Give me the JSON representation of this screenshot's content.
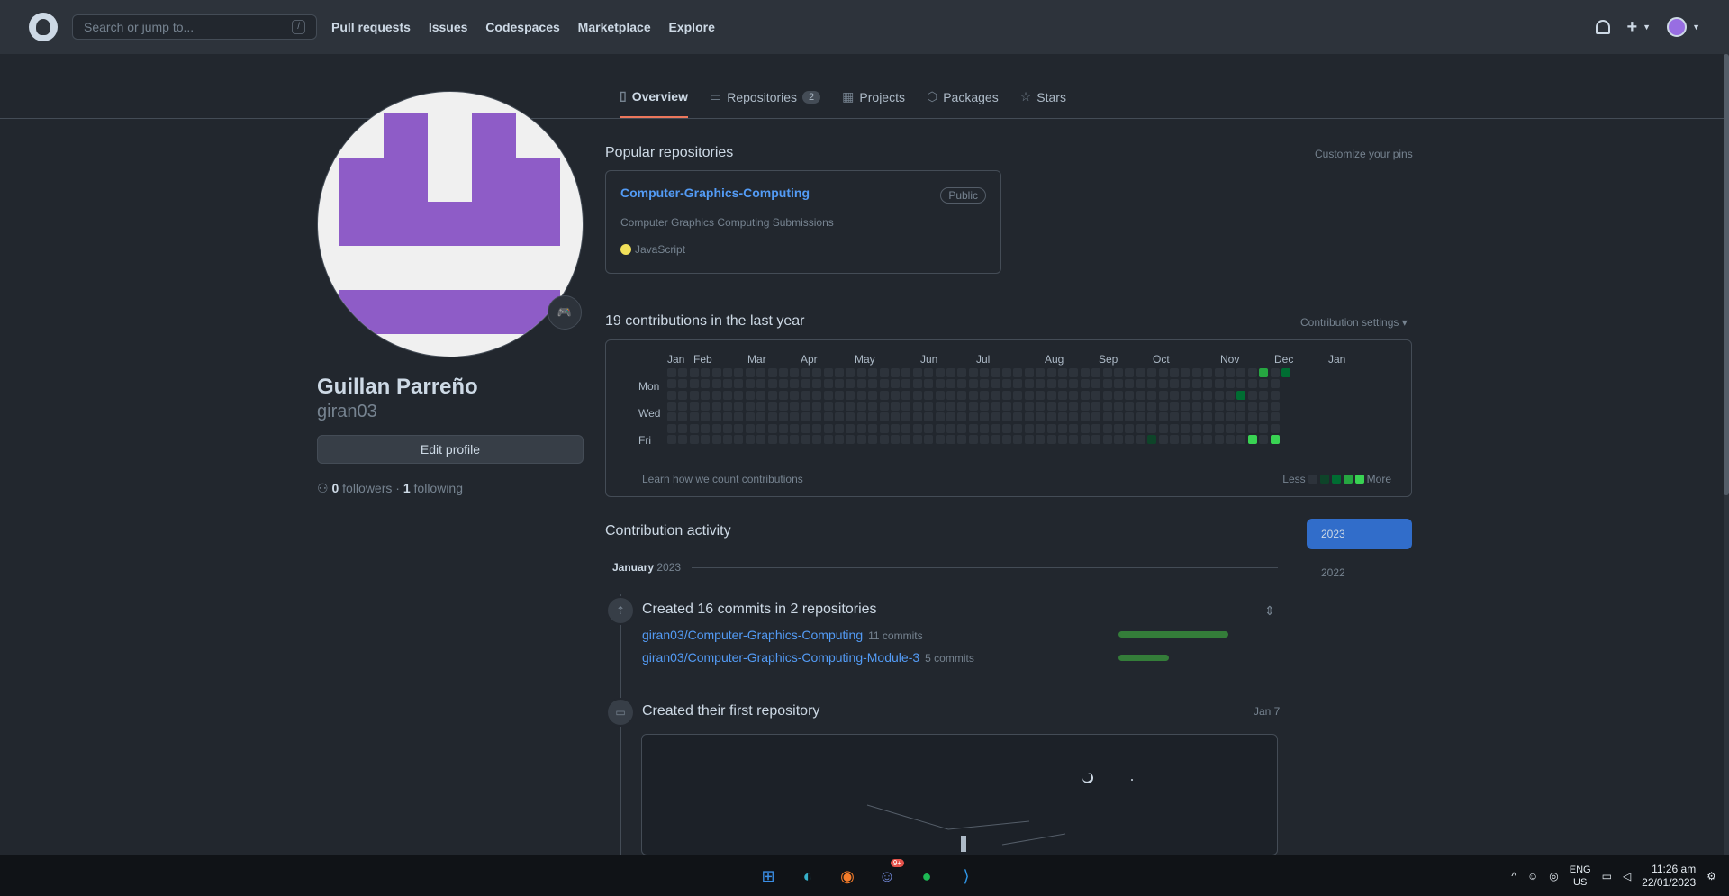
{
  "header": {
    "search_placeholder": "Search or jump to...",
    "search_shortcut": "/",
    "nav": [
      "Pull requests",
      "Issues",
      "Codespaces",
      "Marketplace",
      "Explore"
    ]
  },
  "tabs": [
    {
      "label": "Overview",
      "icon": "book-icon",
      "active": true
    },
    {
      "label": "Repositories",
      "icon": "repo-icon",
      "count": "2"
    },
    {
      "label": "Projects",
      "icon": "table-icon"
    },
    {
      "label": "Packages",
      "icon": "package-icon"
    },
    {
      "label": "Stars",
      "icon": "star-icon"
    }
  ],
  "profile": {
    "name": "Guillan Parreño",
    "username": "giran03",
    "edit_label": "Edit profile",
    "followers_count": "0",
    "followers_label": "followers",
    "following_count": "1",
    "following_label": "following"
  },
  "popular": {
    "title": "Popular repositories",
    "customize": "Customize your pins",
    "repo": {
      "name": "Computer-Graphics-Computing",
      "visibility": "Public",
      "description": "Computer Graphics Computing Submissions",
      "language": "JavaScript",
      "language_color": "#f1e05a"
    }
  },
  "contributions": {
    "title": "19 contributions in the last year",
    "settings": "Contribution settings ▾",
    "months": [
      "Jan",
      "Feb",
      "Mar",
      "Apr",
      "May",
      "Jun",
      "Jul",
      "Aug",
      "Sep",
      "Oct",
      "Nov",
      "Dec",
      "Jan"
    ],
    "days": [
      "Mon",
      "Wed",
      "Fri"
    ],
    "learn": "Learn how we count contributions",
    "less": "Less",
    "more": "More",
    "colors": [
      "#2d333b",
      "#0e4429",
      "#006d32",
      "#26a641",
      "#39d353"
    ]
  },
  "activity": {
    "title": "Contribution activity",
    "years": [
      "2023",
      "2022"
    ],
    "month": "January",
    "month_year": "2023",
    "commits_title": "Created 16 commits in 2 repositories",
    "commit_repos": [
      {
        "name": "giran03/Computer-Graphics-Computing",
        "count": "11 commits",
        "fraction": 1.0
      },
      {
        "name": "giran03/Computer-Graphics-Computing-Module-3",
        "count": "5 commits",
        "fraction": 0.46
      }
    ],
    "first_repo_title": "Created their first repository",
    "first_repo_date": "Jan 7"
  },
  "taskbar": {
    "lang_top": "ENG",
    "lang_bottom": "US",
    "time": "11:26 am",
    "date": "22/01/2023",
    "discord_badge": "9+"
  }
}
